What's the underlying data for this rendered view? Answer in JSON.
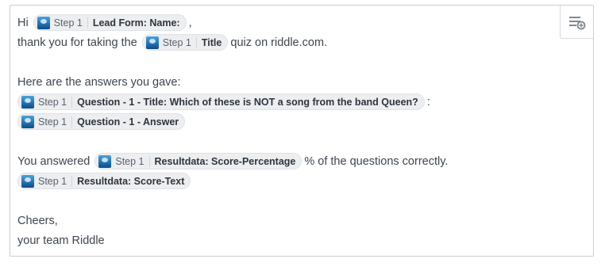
{
  "pill": {
    "step": "Step 1"
  },
  "lines": {
    "greet": {
      "prefix": "Hi",
      "field": "Lead Form: Name:",
      "suffix": ","
    },
    "thanks": {
      "prefix": "thank you for taking the",
      "field": "Title",
      "suffix": "quiz on riddle.com."
    },
    "answers_intro": "Here are the answers you gave:",
    "question": {
      "field": "Question - 1 - Title: Which of these is NOT a song from the band Queen?",
      "suffix": ":"
    },
    "answer": {
      "field": "Question - 1 - Answer"
    },
    "score": {
      "prefix": "You answered",
      "field": "Resultdata: Score-Percentage",
      "suffix": "% of the questions correctly."
    },
    "score_text": {
      "field": "Resultdata: Score-Text"
    },
    "cheers": "Cheers,",
    "signature": "your team Riddle"
  },
  "icons": {
    "insert_field": "insert-field-icon",
    "logo": "riddle-logo-icon"
  }
}
